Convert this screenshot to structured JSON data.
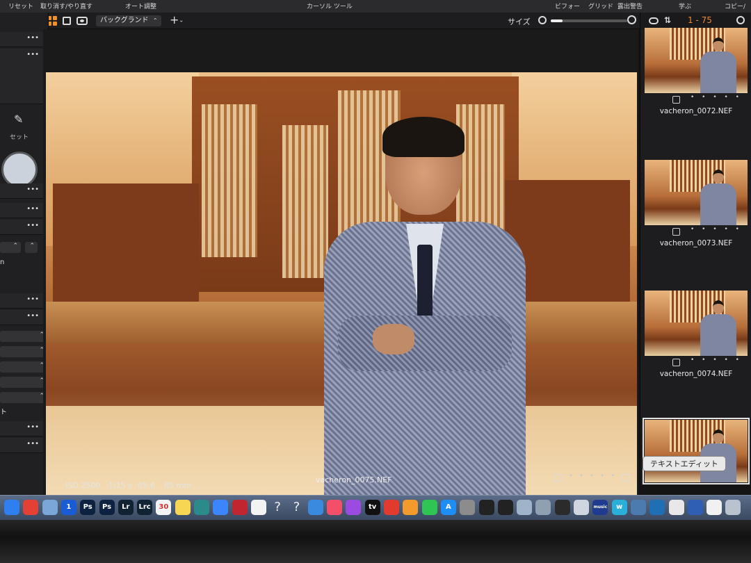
{
  "menubar": {
    "reset": "リセット",
    "undo_redo": "取り消す/やり直す",
    "auto_adjust": "オート調整",
    "cursor_tool": "カーソル ツール",
    "before": "ビフォー",
    "grid": "グリッド",
    "exposure_warning": "露出警告",
    "learn": "学ぶ",
    "copy": "コピー/"
  },
  "toolbar": {
    "background_select": "バックグランド",
    "size_label": "サイズ",
    "zoom_level": 0.15
  },
  "left_panel": {
    "set_label": "セット",
    "more": "•••",
    "field_fragment": "n",
    "side_fragment": "ト"
  },
  "viewer": {
    "iso": "ISO 2500",
    "shutter": "1/15 s",
    "aperture": "f/5.6",
    "focal": "85 mm",
    "filename": "vacheron_0075.NEF",
    "rating_dots": "• • • • •"
  },
  "browser": {
    "count": "1 - 75",
    "thumbnails": [
      {
        "name": "vacheron_0072.NEF",
        "dots": "• • • • •"
      },
      {
        "name": "vacheron_0073.NEF",
        "dots": "• • • • •"
      },
      {
        "name": "vacheron_0074.NEF",
        "dots": "• • • • •"
      },
      {
        "name": "vacheron_0075.NEF",
        "dots": "• • • • •"
      }
    ]
  },
  "tooltip": "テキストエディット",
  "dock": {
    "icons": [
      {
        "name": "finder",
        "label": "",
        "color": "#2f7ff0"
      },
      {
        "name": "chrome",
        "label": "",
        "color": "#e34133"
      },
      {
        "name": "preview",
        "label": "",
        "color": "#7aa7d8"
      },
      {
        "name": "1password",
        "label": "1",
        "color": "#1a5bd6"
      },
      {
        "name": "photoshop-a",
        "label": "Ps",
        "color": "#0c2240"
      },
      {
        "name": "photoshop-b",
        "label": "Ps",
        "color": "#0c2240"
      },
      {
        "name": "lightroom-classic",
        "label": "Lr",
        "color": "#0f2333"
      },
      {
        "name": "lightroom",
        "label": "Lrc",
        "color": "#0f2333"
      },
      {
        "name": "calendar",
        "label": "30",
        "color": "#f4f4f4"
      },
      {
        "name": "notes",
        "label": "",
        "color": "#f7d654"
      },
      {
        "name": "time-machine",
        "label": "",
        "color": "#2b8a8a"
      },
      {
        "name": "messenger",
        "label": "",
        "color": "#3b86ff"
      },
      {
        "name": "photo-booth",
        "label": "",
        "color": "#c0262f"
      },
      {
        "name": "photos",
        "label": "",
        "color": "#f3f3f3"
      },
      {
        "name": "unknown-a",
        "label": "?",
        "color": "transparent"
      },
      {
        "name": "unknown-b",
        "label": "?",
        "color": "transparent"
      },
      {
        "name": "keynote",
        "label": "",
        "color": "#3a8be0"
      },
      {
        "name": "music",
        "label": "",
        "color": "#f44f6a"
      },
      {
        "name": "podcasts",
        "label": "",
        "color": "#9b4be0"
      },
      {
        "name": "apple-tv",
        "label": "tv",
        "color": "#111111"
      },
      {
        "name": "acrobat",
        "label": "",
        "color": "#e23a2f"
      },
      {
        "name": "books",
        "label": "",
        "color": "#f39a2c"
      },
      {
        "name": "facetime",
        "label": "",
        "color": "#2fc552"
      },
      {
        "name": "app-store",
        "label": "A",
        "color": "#1e8ef7"
      },
      {
        "name": "system-prefs",
        "label": "",
        "color": "#8c8c8c"
      },
      {
        "name": "nikon-a",
        "label": "",
        "color": "#222222"
      },
      {
        "name": "nikon-b",
        "label": "",
        "color": "#222222"
      },
      {
        "name": "capture-one",
        "label": "",
        "color": "#9fb4c8"
      },
      {
        "name": "utility",
        "label": "",
        "color": "#8fa0b0"
      },
      {
        "name": "star-app",
        "label": "",
        "color": "#2b2b2b"
      },
      {
        "name": "files",
        "label": "",
        "color": "#cfd6df"
      },
      {
        "name": "amazon-music",
        "label": "music",
        "color": "#1f3b8f"
      },
      {
        "name": "w-app",
        "label": "w",
        "color": "#2ab0d8"
      },
      {
        "name": "image-capture",
        "label": "",
        "color": "#4c7bb0"
      },
      {
        "name": "quicktime",
        "label": "",
        "color": "#1f6fb5"
      },
      {
        "name": "textedit",
        "label": "",
        "color": "#e8e8e8"
      },
      {
        "name": "blue-app",
        "label": "",
        "color": "#2e5fb5"
      },
      {
        "name": "photos-b",
        "label": "",
        "color": "#f1f1f1"
      },
      {
        "name": "trash",
        "label": "",
        "color": "#b9c3cf"
      }
    ]
  }
}
